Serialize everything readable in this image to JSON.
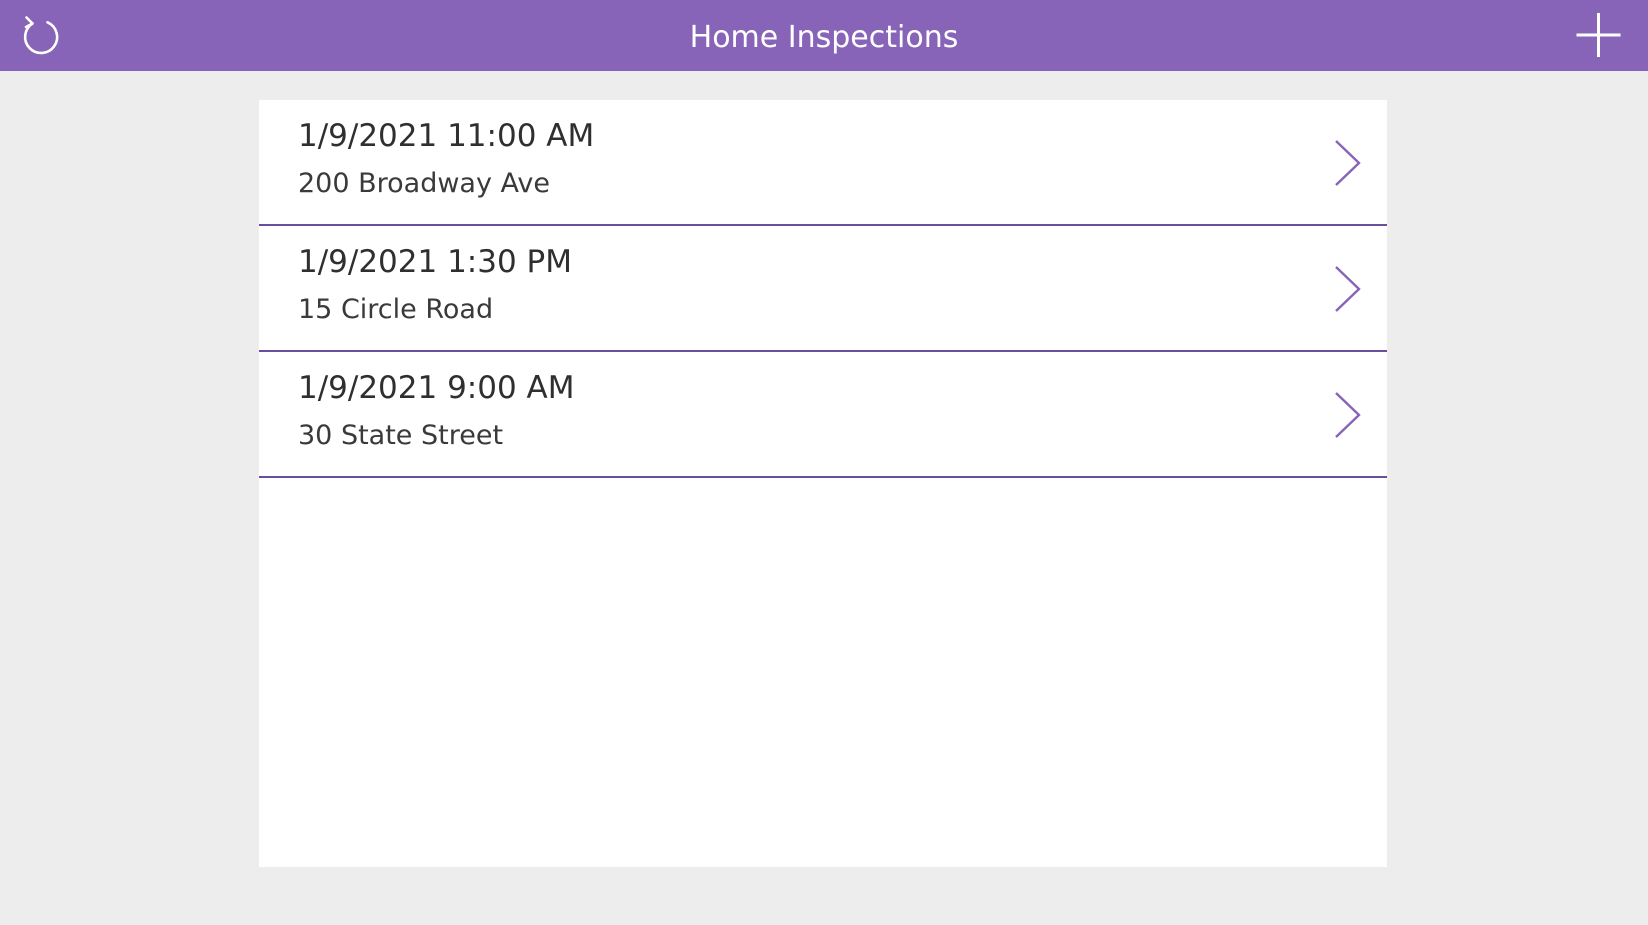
{
  "header": {
    "title": "Home Inspections",
    "refresh_icon": "refresh-icon",
    "add_icon": "plus-icon"
  },
  "colors": {
    "header_bg": "#8764b8",
    "accent": "#8764b8",
    "divider": "#6b4f9a",
    "page_bg": "#ededed"
  },
  "inspections": [
    {
      "datetime": "1/9/2021 11:00 AM",
      "address": "200 Broadway Ave",
      "icon": "chevron-right-icon"
    },
    {
      "datetime": "1/9/2021 1:30 PM",
      "address": "15 Circle Road",
      "icon": "chevron-right-icon"
    },
    {
      "datetime": "1/9/2021 9:00 AM",
      "address": "30 State Street",
      "icon": "chevron-right-icon"
    }
  ]
}
